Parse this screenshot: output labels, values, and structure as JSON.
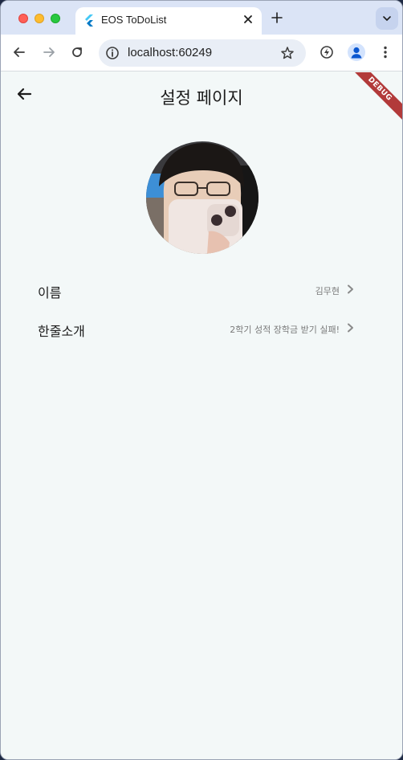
{
  "browser": {
    "tab": {
      "title": "EOS ToDoList"
    },
    "address": {
      "url": "localhost:60249"
    }
  },
  "app": {
    "title": "설정 페이지",
    "debug_banner": "DEBUG",
    "profile_rows": [
      {
        "label": "이름",
        "value": "김무현"
      },
      {
        "label": "한줄소개",
        "value": "2학기 성적 장학금 받기 실패!"
      }
    ]
  },
  "icons": {
    "tab_favicon": "flutter-icon",
    "back": "arrow-left-icon",
    "chevron": "chevron-right-icon"
  },
  "colors": {
    "tabstrip": "#dbe4f6",
    "app_background": "#f3f8f8",
    "debug_banner": "#b23a3a"
  }
}
